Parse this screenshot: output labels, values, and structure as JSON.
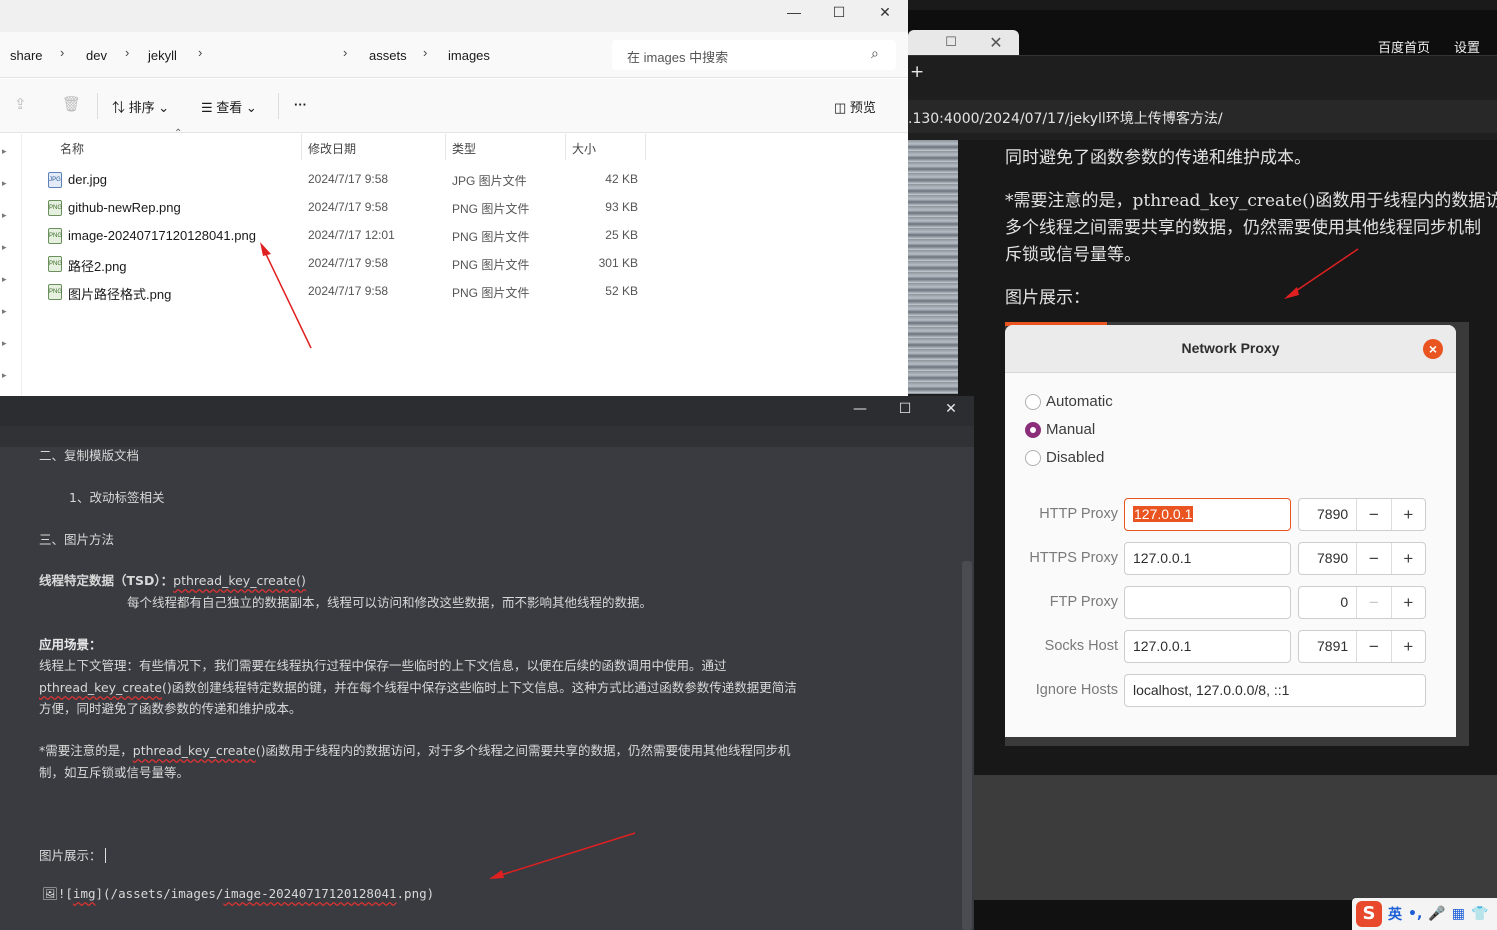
{
  "browser": {
    "top_links": [
      "百度首页",
      "设置"
    ],
    "new_tab": "+",
    "url": ".130:4000/2024/07/17/jekyll环境上传博客方法/",
    "page_lines": [
      "同时避免了函数参数的传递和维护成本。",
      "*需要注意的是，pthread_key_create()函数用于线程内的数据访问",
      "多个线程之间需要共享的数据，仍然需要使用其他线程同步机制",
      "斥锁或信号量等。",
      "图片展示："
    ]
  },
  "ime": {
    "logo": "S",
    "items": [
      "英",
      "•,",
      "🎤",
      "▦",
      "👕"
    ]
  },
  "proxy": {
    "title": "Network Proxy",
    "close": "×",
    "modes": [
      {
        "label": "Automatic",
        "selected": false
      },
      {
        "label": "Manual",
        "selected": true
      },
      {
        "label": "Disabled",
        "selected": false
      }
    ],
    "fields": [
      {
        "label": "HTTP Proxy",
        "host": "127.0.0.1",
        "port": "7890"
      },
      {
        "label": "HTTPS Proxy",
        "host": "127.0.0.1",
        "port": "7890"
      },
      {
        "label": "FTP Proxy",
        "host": "",
        "port": "0"
      },
      {
        "label": "Socks Host",
        "host": "127.0.0.1",
        "port": "7891"
      }
    ],
    "ignore_label": "Ignore Hosts",
    "ignore_value": "localhost, 127.0.0.0/8, ::1",
    "minus": "−",
    "plus": "+"
  },
  "explorer": {
    "window_buttons": [
      "—",
      "☐",
      "✕"
    ],
    "breadcrumb": [
      "share",
      "dev",
      "jekyll",
      "assets",
      "images"
    ],
    "search_placeholder": "在 images 中搜索",
    "commands": {
      "sort": "排序",
      "view": "查看",
      "more": "···",
      "preview": "预览"
    },
    "columns": [
      "名称",
      "修改日期",
      "类型",
      "大小"
    ],
    "files": [
      {
        "name": "der.jpg",
        "date": "2024/7/17 9:58",
        "type": "JPG 图片文件",
        "size": "42 KB",
        "kind": "jpg"
      },
      {
        "name": "github-newRep.png",
        "date": "2024/7/17 9:58",
        "type": "PNG 图片文件",
        "size": "93 KB",
        "kind": "png"
      },
      {
        "name": "image-20240717120128041.png",
        "date": "2024/7/17 12:01",
        "type": "PNG 图片文件",
        "size": "25 KB",
        "kind": "png"
      },
      {
        "name": "路径2.png",
        "date": "2024/7/17 9:58",
        "type": "PNG 图片文件",
        "size": "301 KB",
        "kind": "png"
      },
      {
        "name": "图片路径格式.png",
        "date": "2024/7/17 9:58",
        "type": "PNG 图片文件",
        "size": "52 KB",
        "kind": "png"
      }
    ]
  },
  "editor": {
    "window_buttons": [
      "—",
      "☐",
      "✕"
    ],
    "h_copy": "二、复制模版文档",
    "sub_tags": "1、改动标签相关",
    "h_images": "三、图片方法",
    "tsd_label": "线程特定数据（TSD）：",
    "tsd_func": "pthread_key_create()",
    "tsd_desc": "每个线程都有自己独立的数据副本，线程可以访问和修改这些数据，而不影响其他线程的数据。",
    "scene_label": "应用场景：",
    "scene_1": "线程上下文管理：有些情况下，我们需要在线程执行过程中保存一些临时的上下文信息，以便在后续的函数调用中使用。通过",
    "scene_2_func": "pthread_key_create",
    "scene_2_rest": "()函数创建线程特定数据的键，并在每个线程中保存这些临时上下文信息。这种方式比通过函数参数传递数据更简洁",
    "scene_3": "方便，同时避免了函数参数的传递和维护成本。",
    "note_1_pre": "*需要注意的是，",
    "note_1_func": "pthread_key_create",
    "note_1_rest": "()函数用于线程内的数据访问，对于多个线程之间需要共享的数据，仍然需要使用其他线程同步机",
    "note_2": "制，如互斥锁或信号量等。",
    "img_label": "图片展示：",
    "md_prefix": "🖼![",
    "md_img": "img",
    "md_mid": "](/assets/images/",
    "md_file": "image-20240717120128041",
    "md_end": ".png)"
  }
}
